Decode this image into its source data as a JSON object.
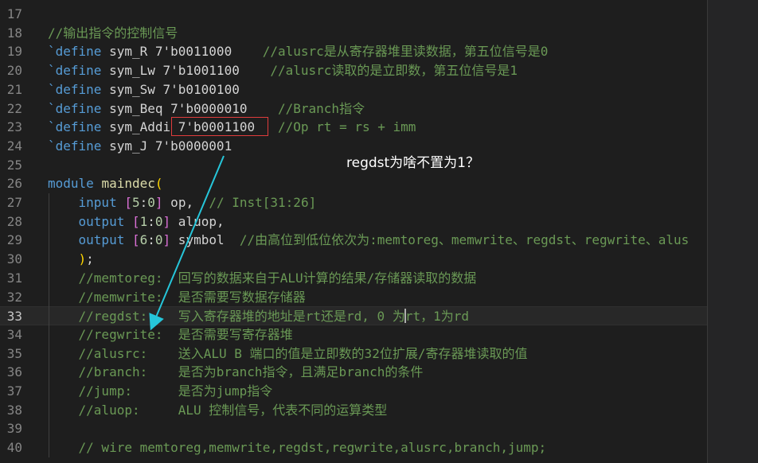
{
  "editor": {
    "top_partial": "                       ░",
    "lines": [
      {
        "num": "17",
        "tokens": []
      },
      {
        "num": "18",
        "tokens": [
          {
            "t": "//输出指令的控制信号",
            "c": "comment"
          }
        ]
      },
      {
        "num": "19",
        "tokens": [
          {
            "t": "`define",
            "c": "macro"
          },
          {
            "t": " sym_R 7'b0011000    ",
            "c": "plain"
          },
          {
            "t": "//alusrc是从寄存器堆里读数据，第五位信号是0",
            "c": "comment"
          }
        ]
      },
      {
        "num": "20",
        "tokens": [
          {
            "t": "`define",
            "c": "macro"
          },
          {
            "t": " sym_Lw 7'b1001100    ",
            "c": "plain"
          },
          {
            "t": "//alusrc读取的是立即数，第五位信号是1",
            "c": "comment"
          }
        ]
      },
      {
        "num": "21",
        "tokens": [
          {
            "t": "`define",
            "c": "macro"
          },
          {
            "t": " sym_Sw 7'b0100100",
            "c": "plain"
          }
        ]
      },
      {
        "num": "22",
        "tokens": [
          {
            "t": "`define",
            "c": "macro"
          },
          {
            "t": " sym_Beq 7'b0000010    ",
            "c": "plain"
          },
          {
            "t": "//Branch指令",
            "c": "comment"
          }
        ]
      },
      {
        "num": "23",
        "tokens": [
          {
            "t": "`define",
            "c": "macro"
          },
          {
            "t": " sym_Addi 7'b0001100   ",
            "c": "plain"
          },
          {
            "t": "//Op rt = rs + imm",
            "c": "comment"
          }
        ]
      },
      {
        "num": "24",
        "tokens": [
          {
            "t": "`define",
            "c": "macro"
          },
          {
            "t": " sym_J 7'b0000001",
            "c": "plain"
          }
        ]
      },
      {
        "num": "25",
        "tokens": []
      },
      {
        "num": "26",
        "tokens": [
          {
            "t": "module",
            "c": "kw"
          },
          {
            "t": " ",
            "c": "plain"
          },
          {
            "t": "maindec",
            "c": "fn"
          },
          {
            "t": "(",
            "c": "brk1"
          }
        ]
      },
      {
        "num": "27",
        "tokens": [
          {
            "t": "    ",
            "c": "plain"
          },
          {
            "t": "input",
            "c": "kw"
          },
          {
            "t": " ",
            "c": "plain"
          },
          {
            "t": "[",
            "c": "brk2"
          },
          {
            "t": "5",
            "c": "num"
          },
          {
            "t": ":",
            "c": "plain"
          },
          {
            "t": "0",
            "c": "num"
          },
          {
            "t": "]",
            "c": "brk2"
          },
          {
            "t": " op,  ",
            "c": "plain"
          },
          {
            "t": "// Inst[31:26]",
            "c": "comment"
          }
        ]
      },
      {
        "num": "28",
        "tokens": [
          {
            "t": "    ",
            "c": "plain"
          },
          {
            "t": "output",
            "c": "kw"
          },
          {
            "t": " ",
            "c": "plain"
          },
          {
            "t": "[",
            "c": "brk2"
          },
          {
            "t": "1",
            "c": "num"
          },
          {
            "t": ":",
            "c": "plain"
          },
          {
            "t": "0",
            "c": "num"
          },
          {
            "t": "]",
            "c": "brk2"
          },
          {
            "t": " aluop,",
            "c": "plain"
          }
        ]
      },
      {
        "num": "29",
        "tokens": [
          {
            "t": "    ",
            "c": "plain"
          },
          {
            "t": "output",
            "c": "kw"
          },
          {
            "t": " ",
            "c": "plain"
          },
          {
            "t": "[",
            "c": "brk2"
          },
          {
            "t": "6",
            "c": "num"
          },
          {
            "t": ":",
            "c": "plain"
          },
          {
            "t": "0",
            "c": "num"
          },
          {
            "t": "]",
            "c": "brk2"
          },
          {
            "t": " symbol  ",
            "c": "plain"
          },
          {
            "t": "//由高位到低位依次为:memtoreg、memwrite、regdst、regwrite、alus",
            "c": "comment"
          }
        ]
      },
      {
        "num": "30",
        "tokens": [
          {
            "t": "    ",
            "c": "plain"
          },
          {
            "t": ")",
            "c": "brk1"
          },
          {
            "t": ";",
            "c": "plain"
          }
        ]
      },
      {
        "num": "31",
        "tokens": [
          {
            "t": "    ",
            "c": "plain"
          },
          {
            "t": "//memtoreg:  回写的数据来自于ALU计算的结果/存储器读取的数据",
            "c": "comment"
          }
        ]
      },
      {
        "num": "32",
        "tokens": [
          {
            "t": "    ",
            "c": "plain"
          },
          {
            "t": "//memwrite:  是否需要写数据存储器",
            "c": "comment"
          }
        ]
      },
      {
        "num": "33",
        "current": true,
        "tokens": [
          {
            "t": "    ",
            "c": "plain"
          },
          {
            "t": "//regdst:    写入寄存器堆的地址是rt还是rd, 0 为rt，1为rd",
            "c": "comment"
          }
        ]
      },
      {
        "num": "34",
        "tokens": [
          {
            "t": "    ",
            "c": "plain"
          },
          {
            "t": "//regwrite:  是否需要写寄存器堆",
            "c": "comment"
          }
        ]
      },
      {
        "num": "35",
        "tokens": [
          {
            "t": "    ",
            "c": "plain"
          },
          {
            "t": "//alusrc:    送入ALU B 端口的值是立即数的32位扩展/寄存器堆读取的值",
            "c": "comment"
          }
        ]
      },
      {
        "num": "36",
        "tokens": [
          {
            "t": "    ",
            "c": "plain"
          },
          {
            "t": "//branch:    是否为branch指令，且满足branch的条件",
            "c": "comment"
          }
        ]
      },
      {
        "num": "37",
        "tokens": [
          {
            "t": "    ",
            "c": "plain"
          },
          {
            "t": "//jump:      是否为jump指令",
            "c": "comment"
          }
        ]
      },
      {
        "num": "38",
        "tokens": [
          {
            "t": "    ",
            "c": "plain"
          },
          {
            "t": "//aluop:     ALU 控制信号，代表不同的运算类型",
            "c": "comment"
          }
        ]
      },
      {
        "num": "39",
        "tokens": []
      },
      {
        "num": "40",
        "tokens": [
          {
            "t": "    ",
            "c": "plain"
          },
          {
            "t": "// wire memtoreg,memwrite,regdst,regwrite,alusrc,branch,jump;",
            "c": "comment"
          }
        ]
      }
    ]
  },
  "annotation": {
    "text": "regdst为啥不置为1？"
  },
  "colors": {
    "arrow": "#26c6da",
    "highlight_box": "#e03c3c"
  }
}
